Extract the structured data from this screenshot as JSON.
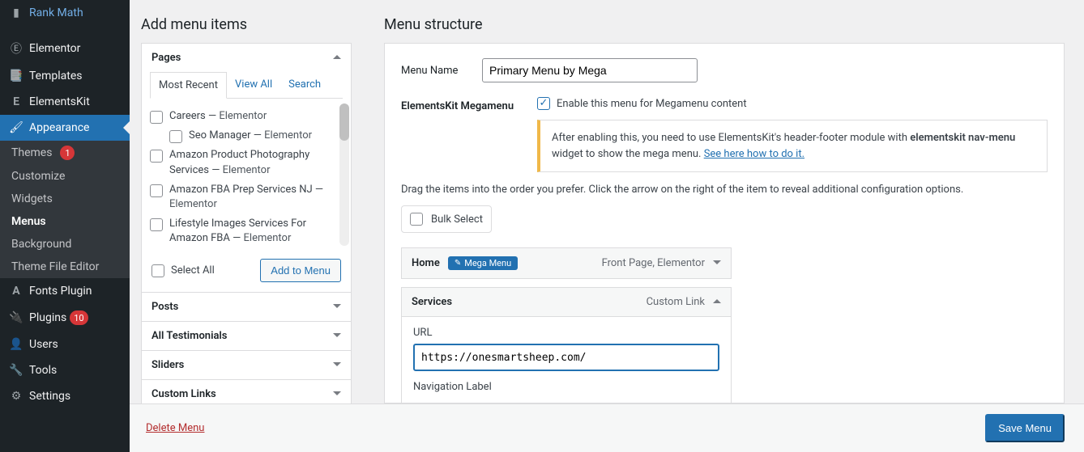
{
  "sidebar": {
    "items": [
      {
        "label": "Rank Math",
        "icon": "chart"
      },
      {
        "label": "Elementor",
        "icon": "elementor"
      },
      {
        "label": "Templates",
        "icon": "templates"
      },
      {
        "label": "ElementsKit",
        "icon": "elementskit"
      },
      {
        "label": "Appearance",
        "icon": "brush"
      },
      {
        "label": "Fonts Plugin",
        "icon": "A"
      },
      {
        "label": "Plugins",
        "icon": "plug",
        "badge": "10"
      },
      {
        "label": "Users",
        "icon": "user"
      },
      {
        "label": "Tools",
        "icon": "wrench"
      },
      {
        "label": "Settings",
        "icon": "sliders"
      }
    ],
    "sub": [
      {
        "label": "Themes",
        "badge": "1"
      },
      {
        "label": "Customize"
      },
      {
        "label": "Widgets"
      },
      {
        "label": "Menus",
        "current": true
      },
      {
        "label": "Background"
      },
      {
        "label": "Theme File Editor"
      }
    ]
  },
  "left": {
    "title": "Add menu items",
    "tabs": {
      "mostRecent": "Most Recent",
      "viewAll": "View All",
      "search": "Search"
    },
    "pages_heading": "Pages",
    "pages": [
      {
        "label": "Careers",
        "suffix": "Elementor"
      },
      {
        "label": "Seo Manager",
        "suffix": "Elementor",
        "indent": true
      },
      {
        "label": "Amazon Product Photography Services",
        "suffix": "Elementor"
      },
      {
        "label": "Amazon FBA Prep Services NJ",
        "suffix": "Elementor"
      },
      {
        "label": "Lifestyle Images Services For Amazon FBA",
        "suffix": "Elementor"
      }
    ],
    "selectAll": "Select All",
    "addBtn": "Add to Menu",
    "accordions": [
      "Posts",
      "All Testimonials",
      "Sliders",
      "Custom Links"
    ]
  },
  "right": {
    "title": "Menu structure",
    "menuNameLabel": "Menu Name",
    "menuName": "Primary Menu by Mega",
    "mmLabel": "ElementsKit Megamenu",
    "mmCheck": "Enable this menu for Megamenu content",
    "mmNote1": "After enabling this, you need to use ElementsKit's header-footer module with ",
    "mmNoteBold": "elementskit nav-menu",
    "mmNote2": " widget to show the mega menu. ",
    "mmNoteLink": "See here how to do it.",
    "dragHint": "Drag the items into the order you prefer. Click the arrow on the right of the item to reveal additional configuration options.",
    "bulkSelect": "Bulk Select",
    "items": {
      "home": {
        "title": "Home",
        "badge": "Mega Menu",
        "meta": "Front Page, Elementor"
      },
      "services": {
        "title": "Services",
        "meta": "Custom Link",
        "urlLabel": "URL",
        "url": "https://onesmartsheep.com/",
        "navLabel": "Navigation Label"
      }
    },
    "deleteMenu": "Delete Menu",
    "saveMenu": "Save Menu"
  }
}
